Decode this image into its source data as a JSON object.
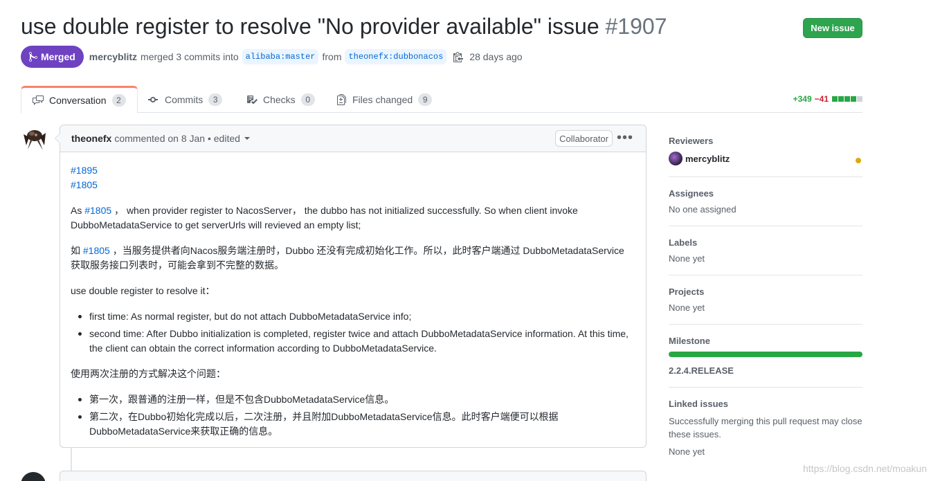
{
  "pr": {
    "title": "use double register to resolve \"No provider available\" issue",
    "number": "#1907",
    "status": "Merged",
    "author": "mercyblitz",
    "action": "merged 3 commits into",
    "base_branch": "alibaba:master",
    "from_text": "from",
    "head_branch": "theonefx:dubbonacos",
    "time": "28 days ago"
  },
  "header": {
    "new_issue_label": "New issue"
  },
  "tabs": [
    {
      "label": "Conversation",
      "count": "2",
      "icon": "comment-discussion-icon"
    },
    {
      "label": "Commits",
      "count": "3",
      "icon": "git-commit-icon"
    },
    {
      "label": "Checks",
      "count": "0",
      "icon": "checklist-icon"
    },
    {
      "label": "Files changed",
      "count": "9",
      "icon": "file-diff-icon"
    }
  ],
  "diffstat": {
    "additions": "+349",
    "deletions": "−41"
  },
  "comment": {
    "author": "theonefx",
    "meta": "commented on 8 Jan • edited",
    "role": "Collaborator",
    "refs": [
      "#1895",
      "#1805"
    ],
    "p1_prefix": "As ",
    "p1_link": "#1805",
    "p1_rest": " ，  when provider register to NacosServer，  the dubbo has not initialized successfully. So when client invoke DubboMetadataService to get serverUrls will revieved an empty list;",
    "p2_prefix": "如 ",
    "p2_link": "#1805",
    "p2_rest": " ，当服务提供者向Nacos服务端注册时，Dubbo 还没有完成初始化工作。所以，此时客户端通过 DubboMetadataService 获取服务接口列表时，可能会拿到不完整的数据。",
    "p3": "use double register to resolve it：",
    "list1": [
      "first time: As normal register, but do not attach DubboMetadataService info;",
      "second time: After Dubbo initialization is completed, register twice and attach DubboMetadataService information. At this time, the client can obtain the correct information according to DubboMetadataService."
    ],
    "p4": "使用两次注册的方式解决这个问题：",
    "list2": [
      "第一次，跟普通的注册一样，但是不包含DubboMetadataService信息。",
      "第二次，在Dubbo初始化完成以后，二次注册，并且附加DubboMetadataService信息。此时客户端便可以根据DubboMetadataService来获取正确的信息。"
    ]
  },
  "sidebar": {
    "reviewers": {
      "heading": "Reviewers",
      "name": "mercyblitz"
    },
    "assignees": {
      "heading": "Assignees",
      "value": "No one assigned"
    },
    "labels": {
      "heading": "Labels",
      "value": "None yet"
    },
    "projects": {
      "heading": "Projects",
      "value": "None yet"
    },
    "milestone": {
      "heading": "Milestone",
      "name": "2.2.4.RELEASE",
      "progress": 1.0
    },
    "linked": {
      "heading": "Linked issues",
      "text": "Successfully merging this pull request may close these issues.",
      "value": "None yet"
    }
  },
  "watermark": "https://blog.csdn.net/moakun",
  "colors": {
    "merged": "#6f42c1",
    "new_issue": "#2ea44f",
    "link": "#0366d6",
    "add": "#28a745",
    "del": "#cb2431",
    "active_tab": "#f9826c"
  }
}
